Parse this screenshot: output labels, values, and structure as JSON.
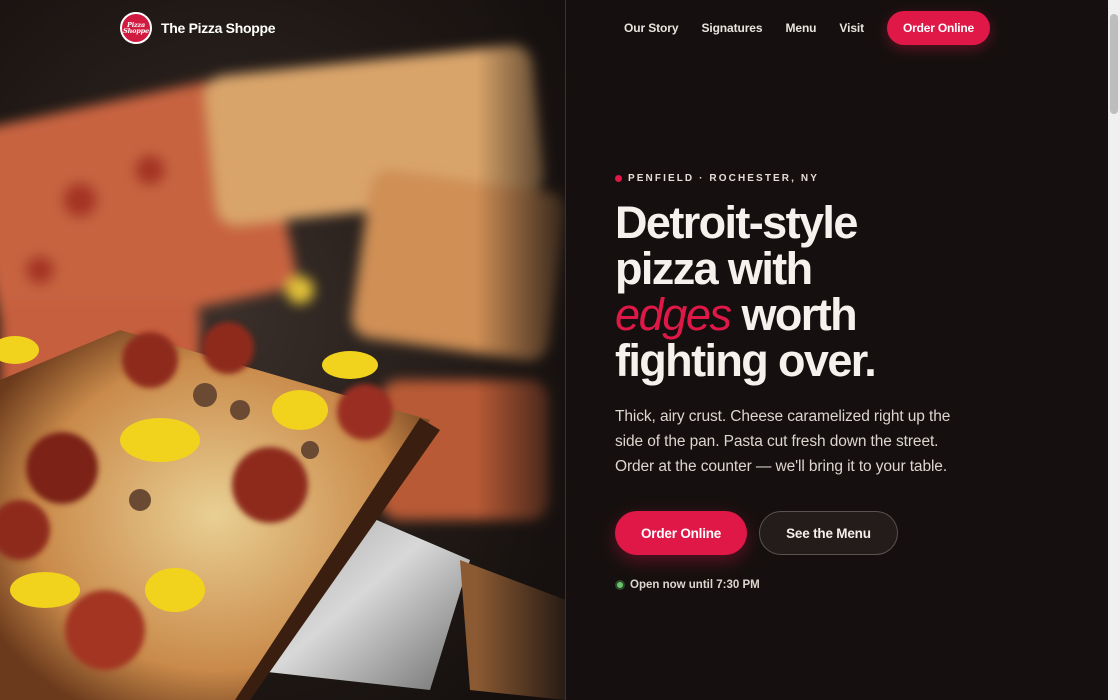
{
  "brand": {
    "logo_line1": "Pizza",
    "logo_line2": "Shoppe",
    "name": "The Pizza Shoppe"
  },
  "nav": {
    "links": [
      "Our Story",
      "Signatures",
      "Menu",
      "Visit"
    ],
    "cta": "Order Online"
  },
  "hero": {
    "eyebrow": "PENFIELD · ROCHESTER, NY",
    "headline_line1": "Detroit-style",
    "headline_line2": "pizza with",
    "headline_accent": "edges",
    "headline_line3_rest": " worth",
    "headline_line4": "fighting over.",
    "lede": "Thick, airy crust. Cheese caramelized right up the side of the pan. Pasta cut fresh down the street. Order at the counter — we'll bring it to your table.",
    "primary_cta": "Order Online",
    "secondary_cta": "See the Menu",
    "status": "Open now until 7:30 PM"
  },
  "colors": {
    "accent": "#e01848",
    "background": "#15100f",
    "status_open": "#6cc36c"
  },
  "icons": {
    "eyebrow_marker": "location-dot-icon",
    "status_indicator": "open-status-dot-icon"
  }
}
